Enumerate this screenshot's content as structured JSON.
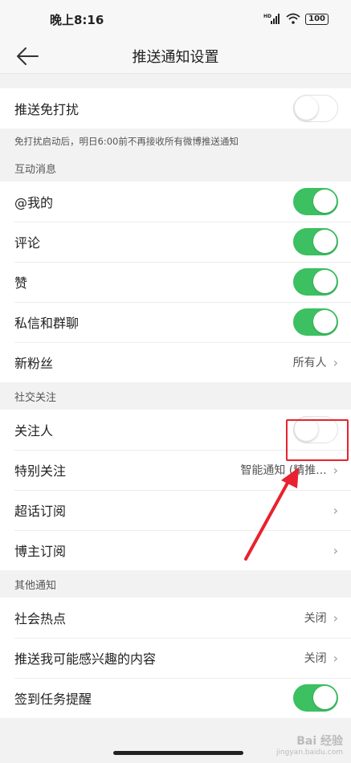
{
  "status": {
    "time": "晚上8:16",
    "signal": "HD",
    "battery": "100"
  },
  "header": {
    "title": "推送通知设置"
  },
  "dnd": {
    "label": "推送免打扰",
    "on": false,
    "note": "免打扰启动后，明日6:00前不再接收所有微博推送通知"
  },
  "interaction": {
    "title": "互动消息",
    "items": [
      {
        "label": "@我的",
        "on": true
      },
      {
        "label": "评论",
        "on": true
      },
      {
        "label": "赞",
        "on": true
      },
      {
        "label": "私信和群聊",
        "on": true
      }
    ],
    "new_fans": {
      "label": "新粉丝",
      "value": "所有人"
    }
  },
  "social": {
    "title": "社交关注",
    "follow": {
      "label": "关注人",
      "on": false
    },
    "special": {
      "label": "特别关注",
      "value": "智能通知 (精推..."
    },
    "super_topic": {
      "label": "超话订阅"
    },
    "blogger": {
      "label": "博主订阅"
    }
  },
  "other": {
    "title": "其他通知",
    "hot": {
      "label": "社会热点",
      "value": "关闭"
    },
    "interest": {
      "label": "推送我可能感兴趣的内容",
      "value": "关闭"
    },
    "checkin": {
      "label": "签到任务提醒",
      "on": true
    }
  },
  "watermark": {
    "line1": "Bai 经验",
    "line2": "jingyan.baidu.com"
  },
  "colors": {
    "toggle_on": "#3cc061",
    "annotation": "#e8222e"
  },
  "icons": {
    "back": "arrow-left-icon",
    "chevron": "chevron-right-icon",
    "wifi": "wifi-icon",
    "battery": "battery-icon"
  }
}
